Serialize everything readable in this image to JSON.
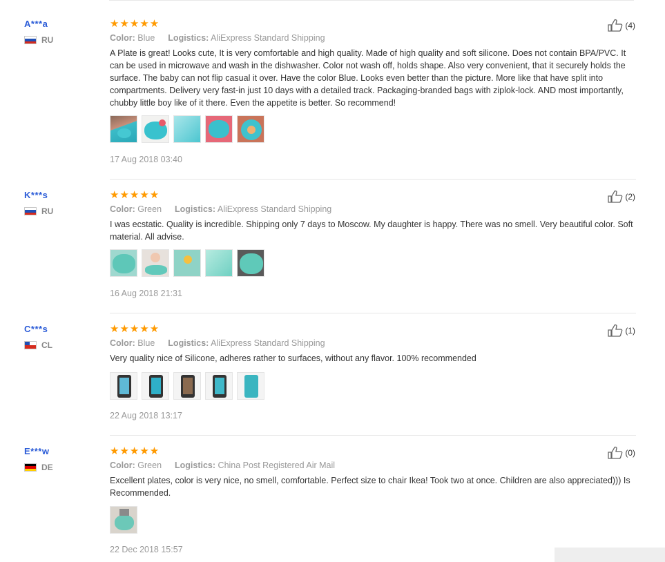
{
  "reviews": [
    {
      "name": "A***a",
      "country": "RU",
      "flag": [
        "#ffffff",
        "#1f4fb6",
        "#d52b1e"
      ],
      "stars": "★★★★★",
      "color_label": "Color:",
      "color_value": "Blue",
      "logistics_label": "Logistics:",
      "logistics_value": "AliExpress Standard Shipping",
      "text": "A Plate is great! Looks cute, It is very comfortable and high quality. Made of high quality and soft silicone. Does not contain BPA/PVC. It can be used in microwave and wash in the dishwasher. Color not wash off, holds shape. Also very convenient, that it securely holds the surface. The baby can not flip casual it over. Have the color Blue. Looks even better than the picture. More like that have split into compartments. Delivery very fast-in just 10 days with a detailed track. Packaging-branded bags with ziplok-lock. AND most importantly, chubby little boy like of it there. Even the appetite is better. So recommend!",
      "photo_count": 5,
      "date": "17 Aug 2018 03:40",
      "helpful": "(4)"
    },
    {
      "name": "K***s",
      "country": "RU",
      "flag": [
        "#ffffff",
        "#1f4fb6",
        "#d52b1e"
      ],
      "stars": "★★★★★",
      "color_label": "Color:",
      "color_value": "Green",
      "logistics_label": "Logistics:",
      "logistics_value": "AliExpress Standard Shipping",
      "text": "I was ecstatic. Quality is incredible. Shipping only 7 days to Moscow. My daughter is happy. There was no smell. Very beautiful color. Soft material. All advise.",
      "photo_count": 5,
      "date": "16 Aug 2018 21:31",
      "helpful": "(2)"
    },
    {
      "name": "C***s",
      "country": "CL",
      "flag": [
        "#ffffff",
        "#d52b1e"
      ],
      "stars": "★★★★★",
      "color_label": "Color:",
      "color_value": "Blue",
      "logistics_label": "Logistics:",
      "logistics_value": "AliExpress Standard Shipping",
      "text": "Very quality nice of Silicone, adheres rather to surfaces, without any flavor. 100% recommended",
      "photo_count": 5,
      "date": "22 Aug 2018 13:17",
      "helpful": "(1)"
    },
    {
      "name": "E***w",
      "country": "DE",
      "flag": [
        "#000000",
        "#dd0000",
        "#ffce00"
      ],
      "stars": "★★★★★",
      "color_label": "Color:",
      "color_value": "Green",
      "logistics_label": "Logistics:",
      "logistics_value": "China Post Registered Air Mail",
      "text": "Excellent plates, color is very nice, no smell, comfortable. Perfect size to chair Ikea! Took two at once. Children are also appreciated))) Is Recommended.",
      "photo_count": 1,
      "date": "22 Dec 2018 15:57",
      "helpful": "(0)"
    }
  ],
  "icons": {
    "helpful": "thumbs-up-icon",
    "photo": "review-photo"
  },
  "colors": {
    "reviewer_name": "#2a5bd7",
    "stars": "#ff9a00",
    "meta": "#999999",
    "plate_teal": "#3cc3cf"
  }
}
